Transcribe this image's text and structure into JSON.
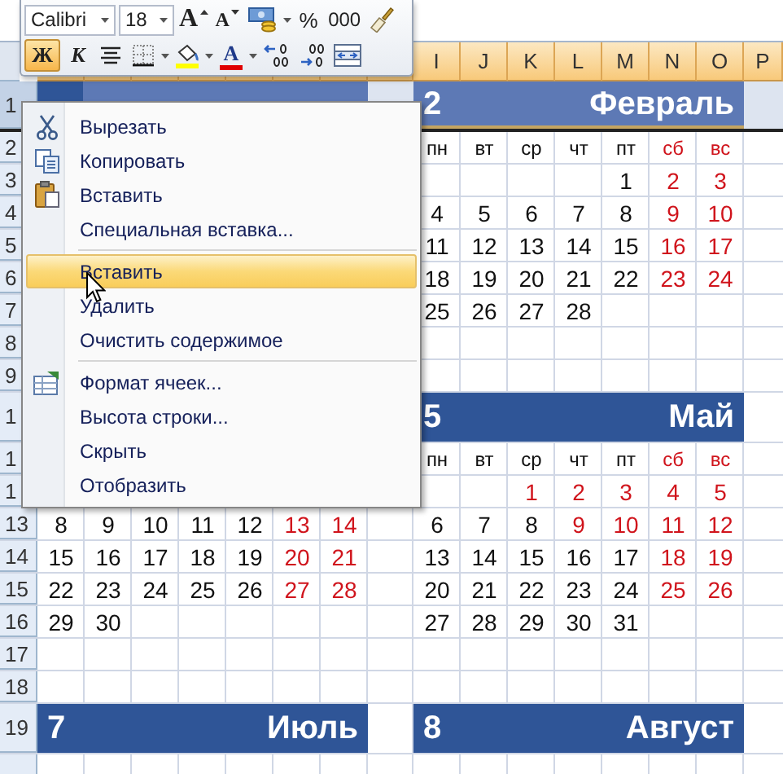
{
  "mini_toolbar": {
    "rows": [
      {
        "controls": [
          {
            "kind": "font-field",
            "value": "Calibri"
          },
          {
            "kind": "size-field",
            "value": "18"
          },
          {
            "kind": "grow-font",
            "label": "A"
          },
          {
            "kind": "shrink-font",
            "label": "A"
          },
          {
            "kind": "accounting"
          },
          {
            "kind": "percent",
            "label": "%"
          },
          {
            "kind": "thousands",
            "label": "000"
          },
          {
            "kind": "painter"
          }
        ]
      },
      {
        "controls": [
          {
            "kind": "bold",
            "label": "Ж",
            "on": true
          },
          {
            "kind": "italic",
            "label": "К",
            "on": false
          },
          {
            "kind": "align"
          },
          {
            "kind": "borders"
          },
          {
            "kind": "fill"
          },
          {
            "kind": "font-color",
            "label": "A"
          },
          {
            "kind": "inc-decimal"
          },
          {
            "kind": "dec-decimal"
          },
          {
            "kind": "merge"
          }
        ]
      }
    ]
  },
  "column_headers": [
    "I",
    "J",
    "K",
    "L",
    "M",
    "N",
    "O",
    "P"
  ],
  "rows": [
    {
      "label": "1",
      "selected": true,
      "left": {
        "kind": "month"
      },
      "right": {
        "kind": "month",
        "number": "2",
        "name": "Февраль"
      }
    },
    {
      "label": "2",
      "selected": false,
      "right": {
        "kind": "weekdays",
        "days": [
          {
            "text": "пн",
            "weekend": false
          },
          {
            "text": "вт",
            "weekend": false
          },
          {
            "text": "ср",
            "weekend": false
          },
          {
            "text": "чт",
            "weekend": false
          },
          {
            "text": "пт",
            "weekend": false
          },
          {
            "text": "сб",
            "weekend": true
          },
          {
            "text": "вс",
            "weekend": true
          }
        ]
      }
    },
    {
      "label": "3",
      "selected": false,
      "right": {
        "kind": "dates",
        "cells": [
          null,
          null,
          null,
          null,
          {
            "text": "1",
            "holiday": false
          },
          {
            "text": "2",
            "holiday": true
          },
          {
            "text": "3",
            "holiday": true
          }
        ]
      }
    },
    {
      "label": "4",
      "selected": false,
      "right": {
        "kind": "dates",
        "cells": [
          {
            "text": "4",
            "holiday": false
          },
          {
            "text": "5",
            "holiday": false
          },
          {
            "text": "6",
            "holiday": false
          },
          {
            "text": "7",
            "holiday": false
          },
          {
            "text": "8",
            "holiday": false
          },
          {
            "text": "9",
            "holiday": true
          },
          {
            "text": "10",
            "holiday": true
          }
        ]
      }
    },
    {
      "label": "5",
      "selected": false,
      "right": {
        "kind": "dates",
        "cells": [
          {
            "text": "11",
            "holiday": false
          },
          {
            "text": "12",
            "holiday": false
          },
          {
            "text": "13",
            "holiday": false
          },
          {
            "text": "14",
            "holiday": false
          },
          {
            "text": "15",
            "holiday": false
          },
          {
            "text": "16",
            "holiday": true
          },
          {
            "text": "17",
            "holiday": true
          }
        ]
      }
    },
    {
      "label": "6",
      "selected": false,
      "right": {
        "kind": "dates",
        "cells": [
          {
            "text": "18",
            "holiday": false
          },
          {
            "text": "19",
            "holiday": false
          },
          {
            "text": "20",
            "holiday": false
          },
          {
            "text": "21",
            "holiday": false
          },
          {
            "text": "22",
            "holiday": false
          },
          {
            "text": "23",
            "holiday": true
          },
          {
            "text": "24",
            "holiday": true
          }
        ]
      }
    },
    {
      "label": "7",
      "selected": false,
      "right": {
        "kind": "dates",
        "cells": [
          {
            "text": "25",
            "holiday": false
          },
          {
            "text": "26",
            "holiday": false
          },
          {
            "text": "27",
            "holiday": false
          },
          {
            "text": "28",
            "holiday": false
          }
        ]
      }
    },
    {
      "label": "8",
      "selected": false
    },
    {
      "label": "9",
      "selected": false
    },
    {
      "label": "1",
      "selected": false,
      "right": {
        "kind": "month",
        "number": "5",
        "name": "Май"
      }
    },
    {
      "label": "1",
      "selected": false,
      "right": {
        "kind": "weekdays",
        "days": [
          {
            "text": "пн",
            "weekend": false
          },
          {
            "text": "вт",
            "weekend": false
          },
          {
            "text": "ср",
            "weekend": false
          },
          {
            "text": "чт",
            "weekend": false
          },
          {
            "text": "пт",
            "weekend": false
          },
          {
            "text": "сб",
            "weekend": true
          },
          {
            "text": "вс",
            "weekend": true
          }
        ]
      }
    },
    {
      "label": "1",
      "selected": false,
      "right": {
        "kind": "dates",
        "cells": [
          null,
          null,
          {
            "text": "1",
            "holiday": true
          },
          {
            "text": "2",
            "holiday": true
          },
          {
            "text": "3",
            "holiday": true
          },
          {
            "text": "4",
            "holiday": true
          },
          {
            "text": "5",
            "holiday": true
          }
        ]
      }
    },
    {
      "label": "13",
      "selected": false,
      "left": {
        "kind": "dates",
        "cells": [
          {
            "text": "8",
            "holiday": false
          },
          {
            "text": "9",
            "holiday": false
          },
          {
            "text": "10",
            "holiday": false
          },
          {
            "text": "11",
            "holiday": false
          },
          {
            "text": "12",
            "holiday": false
          },
          {
            "text": "13",
            "holiday": true
          },
          {
            "text": "14",
            "holiday": true
          }
        ]
      },
      "right": {
        "kind": "dates",
        "cells": [
          {
            "text": "6",
            "holiday": false
          },
          {
            "text": "7",
            "holiday": false
          },
          {
            "text": "8",
            "holiday": false
          },
          {
            "text": "9",
            "holiday": true
          },
          {
            "text": "10",
            "holiday": true
          },
          {
            "text": "11",
            "holiday": true
          },
          {
            "text": "12",
            "holiday": true
          }
        ]
      }
    },
    {
      "label": "14",
      "selected": false,
      "left": {
        "kind": "dates",
        "cells": [
          {
            "text": "15",
            "holiday": false
          },
          {
            "text": "16",
            "holiday": false
          },
          {
            "text": "17",
            "holiday": false
          },
          {
            "text": "18",
            "holiday": false
          },
          {
            "text": "19",
            "holiday": false
          },
          {
            "text": "20",
            "holiday": true
          },
          {
            "text": "21",
            "holiday": true
          }
        ]
      },
      "right": {
        "kind": "dates",
        "cells": [
          {
            "text": "13",
            "holiday": false
          },
          {
            "text": "14",
            "holiday": false
          },
          {
            "text": "15",
            "holiday": false
          },
          {
            "text": "16",
            "holiday": false
          },
          {
            "text": "17",
            "holiday": false
          },
          {
            "text": "18",
            "holiday": true
          },
          {
            "text": "19",
            "holiday": true
          }
        ]
      }
    },
    {
      "label": "15",
      "selected": false,
      "left": {
        "kind": "dates",
        "cells": [
          {
            "text": "22",
            "holiday": false
          },
          {
            "text": "23",
            "holiday": false
          },
          {
            "text": "24",
            "holiday": false
          },
          {
            "text": "25",
            "holiday": false
          },
          {
            "text": "26",
            "holiday": false
          },
          {
            "text": "27",
            "holiday": true
          },
          {
            "text": "28",
            "holiday": true
          }
        ]
      },
      "right": {
        "kind": "dates",
        "cells": [
          {
            "text": "20",
            "holiday": false
          },
          {
            "text": "21",
            "holiday": false
          },
          {
            "text": "22",
            "holiday": false
          },
          {
            "text": "23",
            "holiday": false
          },
          {
            "text": "24",
            "holiday": false
          },
          {
            "text": "25",
            "holiday": true
          },
          {
            "text": "26",
            "holiday": true
          }
        ]
      }
    },
    {
      "label": "16",
      "selected": false,
      "left": {
        "kind": "dates",
        "cells": [
          {
            "text": "29",
            "holiday": false
          },
          {
            "text": "30",
            "holiday": false
          }
        ]
      },
      "right": {
        "kind": "dates",
        "cells": [
          {
            "text": "27",
            "holiday": false
          },
          {
            "text": "28",
            "holiday": false
          },
          {
            "text": "29",
            "holiday": false
          },
          {
            "text": "30",
            "holiday": false
          },
          {
            "text": "31",
            "holiday": false
          }
        ]
      }
    },
    {
      "label": "17",
      "selected": false
    },
    {
      "label": "18",
      "selected": false
    },
    {
      "label": "19",
      "selected": false,
      "left": {
        "kind": "month",
        "number": "7",
        "name": "Июль"
      },
      "right": {
        "kind": "month",
        "number": "8",
        "name": "Август"
      }
    }
  ],
  "context_menu": {
    "items": [
      {
        "kind": "cut",
        "label": "Вырезать",
        "selected": false
      },
      {
        "kind": "copy",
        "label": "Копировать",
        "selected": false
      },
      {
        "kind": "paste",
        "label": "Вставить",
        "selected": false
      },
      {
        "kind": "plain",
        "label": "Специальная вставка...",
        "selected": false
      },
      {
        "kind": "separator"
      },
      {
        "kind": "plain",
        "label": "Вставить",
        "selected": true
      },
      {
        "kind": "plain",
        "label": "Удалить",
        "selected": false
      },
      {
        "kind": "plain",
        "label": "Очистить содержимое",
        "selected": false
      },
      {
        "kind": "separator"
      },
      {
        "kind": "format",
        "label": "Формат ячеек...",
        "selected": false
      },
      {
        "kind": "plain",
        "label": "Высота строки...",
        "selected": false
      },
      {
        "kind": "plain",
        "label": "Скрыть",
        "selected": false
      },
      {
        "kind": "plain",
        "label": "Отобразить",
        "selected": false
      }
    ]
  }
}
